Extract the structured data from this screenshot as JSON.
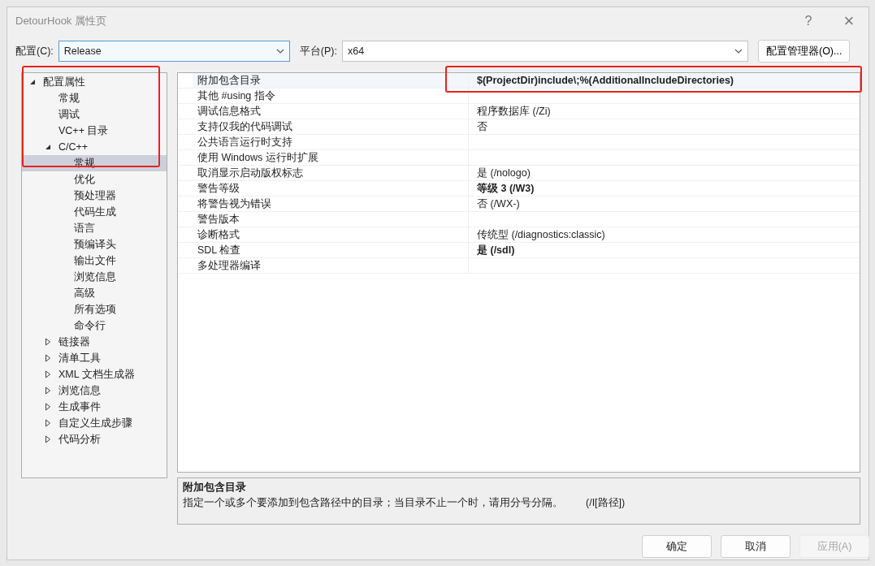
{
  "window": {
    "title": "DetourHook 属性页",
    "help": "?",
    "close": "×"
  },
  "toolbar": {
    "config_label": "配置(C):",
    "config_value": "Release",
    "platform_label": "平台(P):",
    "platform_value": "x64",
    "manager_button": "配置管理器(O)..."
  },
  "tree": [
    {
      "label": "配置属性",
      "kind": "folder",
      "expanded": true,
      "selected": false,
      "children": [
        {
          "label": "常规",
          "kind": "page",
          "selected": false
        },
        {
          "label": "调试",
          "kind": "page",
          "selected": false
        },
        {
          "label": "VC++ 目录",
          "kind": "page",
          "selected": false
        },
        {
          "label": "C/C++",
          "kind": "folder",
          "expanded": true,
          "selected": false,
          "children": [
            {
              "label": "常规",
              "kind": "page",
              "selected": true
            },
            {
              "label": "优化",
              "kind": "page",
              "selected": false
            },
            {
              "label": "预处理器",
              "kind": "page",
              "selected": false
            },
            {
              "label": "代码生成",
              "kind": "page",
              "selected": false
            },
            {
              "label": "语言",
              "kind": "page",
              "selected": false
            },
            {
              "label": "预编译头",
              "kind": "page",
              "selected": false
            },
            {
              "label": "输出文件",
              "kind": "page",
              "selected": false
            },
            {
              "label": "浏览信息",
              "kind": "page",
              "selected": false
            },
            {
              "label": "高级",
              "kind": "page",
              "selected": false
            },
            {
              "label": "所有选项",
              "kind": "page",
              "selected": false
            },
            {
              "label": "命令行",
              "kind": "page",
              "selected": false
            }
          ]
        },
        {
          "label": "链接器",
          "kind": "folder",
          "expanded": false,
          "selected": false
        },
        {
          "label": "清单工具",
          "kind": "folder",
          "expanded": false,
          "selected": false
        },
        {
          "label": "XML 文档生成器",
          "kind": "folder",
          "expanded": false,
          "selected": false
        },
        {
          "label": "浏览信息",
          "kind": "folder",
          "expanded": false,
          "selected": false
        },
        {
          "label": "生成事件",
          "kind": "folder",
          "expanded": false,
          "selected": false
        },
        {
          "label": "自定义生成步骤",
          "kind": "folder",
          "expanded": false,
          "selected": false
        },
        {
          "label": "代码分析",
          "kind": "folder",
          "expanded": false,
          "selected": false
        }
      ]
    }
  ],
  "properties": [
    {
      "name": "附加包含目录",
      "value": "$(ProjectDir)include\\;%(AdditionalIncludeDirectories)",
      "modified": true,
      "selected": true
    },
    {
      "name": "其他 #using 指令",
      "selected": false
    },
    {
      "name": "调试信息格式",
      "value": "程序数据库 (/Zi)",
      "modified": false,
      "selected": false
    },
    {
      "name": "支持仅我的代码调试",
      "value": "否",
      "modified": false,
      "selected": false
    },
    {
      "name": "公共语言运行时支持",
      "selected": false
    },
    {
      "name": "使用 Windows 运行时扩展",
      "selected": false
    },
    {
      "name": "取消显示启动版权标志",
      "value": "是 (/nologo)",
      "modified": false,
      "selected": false
    },
    {
      "name": "警告等级",
      "value": "等级 3 (/W3)",
      "modified": true,
      "selected": false
    },
    {
      "name": "将警告视为错误",
      "value": "否 (/WX-)",
      "modified": false,
      "selected": false
    },
    {
      "name": "警告版本",
      "selected": false
    },
    {
      "name": "诊断格式",
      "value": "传统型 (/diagnostics:classic)",
      "modified": false,
      "selected": false
    },
    {
      "name": "SDL 检查",
      "value": "是 (/sdl)",
      "modified": true,
      "selected": false
    },
    {
      "name": "多处理器编译",
      "selected": false
    }
  ],
  "description": {
    "title": "附加包含目录",
    "text": "指定一个或多个要添加到包含路径中的目录；当目录不止一个时，请用分号分隔。",
    "flag": "(/I[路径])"
  },
  "buttons": [
    {
      "label": "确定",
      "disabled": false
    },
    {
      "label": "取消",
      "disabled": false
    },
    {
      "label": "应用(A)",
      "disabled": true
    }
  ]
}
